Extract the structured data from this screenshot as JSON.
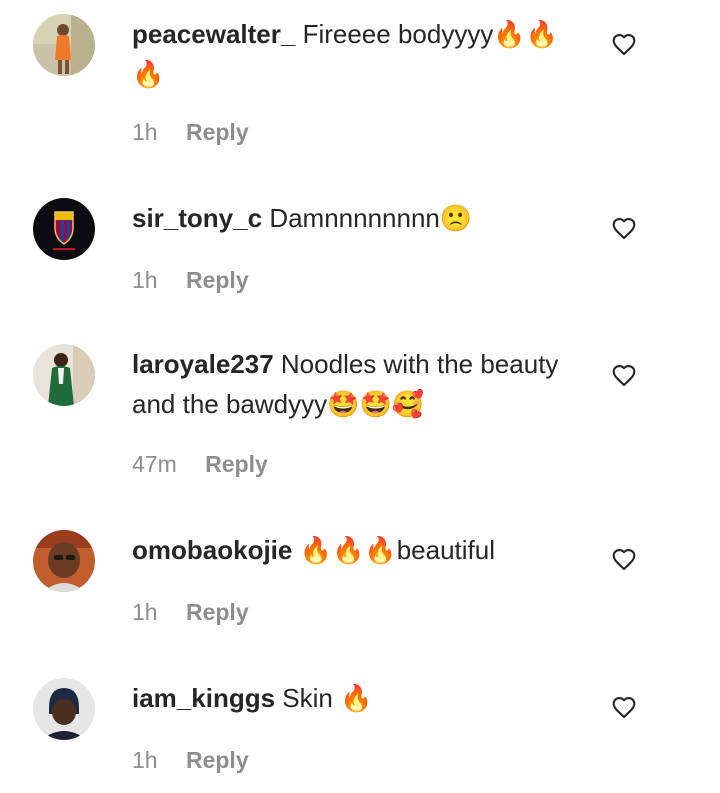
{
  "reply_label": "Reply",
  "icons": {
    "like": "heart-outline-icon"
  },
  "comments": [
    {
      "username": "peacewalter_",
      "text": "Fireeee bodyyyy🔥🔥🔥",
      "time": "1h"
    },
    {
      "username": "sir_tony_c",
      "text": "Damnnnnnnnn🙁",
      "time": "1h"
    },
    {
      "username": "laroyale237",
      "text": "Noodles with the beauty and the bawdyyy🤩🤩🥰",
      "time": "47m"
    },
    {
      "username": "omobaokojie",
      "text": "🔥🔥🔥beautiful",
      "time": "1h"
    },
    {
      "username": "iam_kinggs",
      "text": "Skin 🔥",
      "time": "1h"
    }
  ]
}
